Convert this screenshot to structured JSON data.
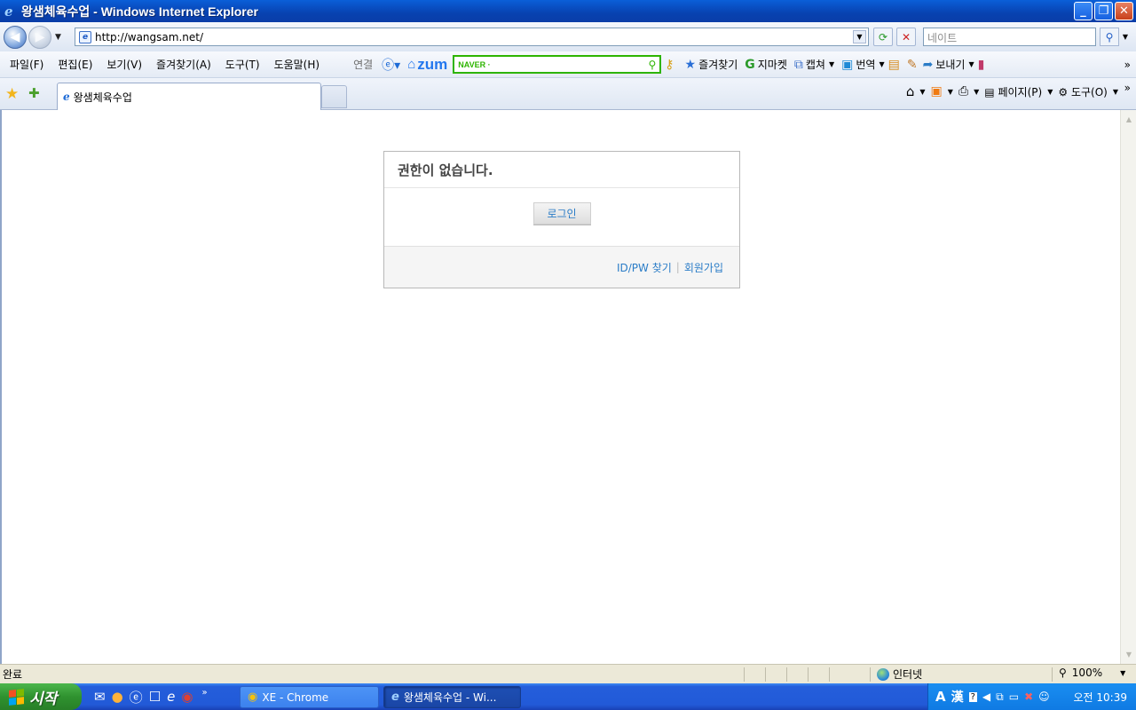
{
  "window": {
    "title": "왕샘체육수업 - Windows Internet Explorer",
    "minimize": "_",
    "maximize": "❐",
    "close": "✕"
  },
  "address": {
    "url": "http://wangsam.net/",
    "search_placeholder": "네이트"
  },
  "menu": [
    "파일(F)",
    "편집(E)",
    "보기(V)",
    "즐겨찾기(A)",
    "도구(T)",
    "도움말(H)"
  ],
  "toolbar": {
    "link_label": "연결",
    "zum_label": "zum",
    "naver_label": "NAVER ·",
    "favorites_label": "즐겨찾기",
    "gmarket_label": "지마켓",
    "capture_label": "캡쳐",
    "translate_label": "번역",
    "send_label": "보내기"
  },
  "tab": {
    "title": "왕샘체육수업"
  },
  "command_bar": {
    "page_label": "페이지(P)",
    "tools_label": "도구(O)"
  },
  "content": {
    "heading": "권한이 없습니다.",
    "login_button": "로그인",
    "find_idpw": "ID/PW 찾기",
    "separator": "|",
    "signup": "회원가입"
  },
  "status": {
    "text": "완료",
    "zone": "인터넷",
    "zoom": "100%"
  },
  "taskbar": {
    "start": "시작",
    "tasks": [
      {
        "label": "XE - Chrome"
      },
      {
        "label": "왕샘체육수업 - Wi..."
      }
    ],
    "clock": "오전 10:39"
  }
}
